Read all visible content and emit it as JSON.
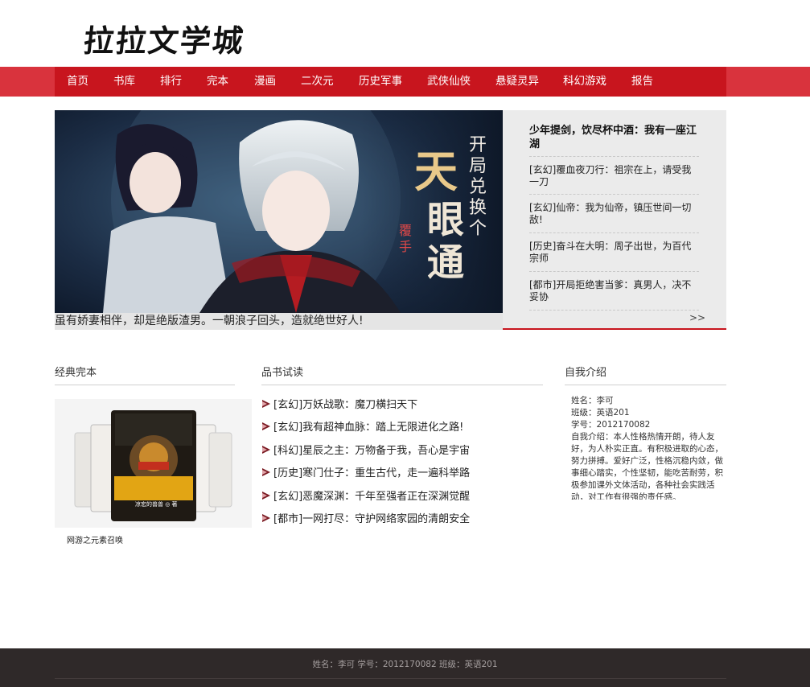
{
  "site": {
    "logo_text": "拉拉文学城"
  },
  "nav": {
    "items": [
      "首页",
      "书库",
      "排行",
      "完本",
      "漫画",
      "二次元",
      "历史军事",
      "武侠仙侠",
      "悬疑灵异",
      "科幻游戏",
      "报告"
    ]
  },
  "hero": {
    "cover_title": "开局兑换个天眼通",
    "cover_author": "覆手",
    "caption": "虽有娇妻相伴，却是绝版渣男。一朝浪子回头，造就绝世好人!"
  },
  "side": {
    "title": "少年提剑，饮尽杯中酒：我有一座江湖",
    "items": [
      "[玄幻]覆血夜刀行：祖宗在上，请受我一刀",
      "[玄幻]仙帝：我为仙帝，镇压世间一切敌!",
      "[历史]奋斗在大明：周子出世，为百代宗师",
      "[都市]开局拒绝害当爹：真男人，决不妥协"
    ],
    "more": ">>"
  },
  "sections": {
    "classic": "经典完本",
    "trial": "品书试读",
    "intro": "自我介绍"
  },
  "classic": {
    "cover_title": "网游之元素召唤",
    "cover_author": "凉宏的兽兽 ◎ 著",
    "caption": "网游之元素召唤"
  },
  "trial_items": [
    "[玄幻]万妖战歌：魔刀横扫天下",
    "[玄幻]我有超神血脉：踏上无限进化之路!",
    "[科幻]星辰之主：万物备于我，吾心是宇宙",
    "[历史]寒门仕子：重生古代，走一遍科举路",
    "[玄幻]恶魔深渊：千年至强者正在深渊觉醒",
    "[都市]一网打尽：守护网络家园的清朗安全"
  ],
  "intro": {
    "lines": [
      "姓名：李可",
      "班级：英语201",
      "学号：2012170082",
      "自我介绍：本人性格热情开朗，待人友好，为人朴实正直。有积极进取的心态，努力拼搏。爱好广泛，性格沉稳内敛，做事细心踏实，个性坚韧，能吃苦耐劳，积极参加课外文体活动，各种社会实践活动，对工作有很强的责任感。"
    ]
  },
  "footer": {
    "text": "姓名：李可 学号：2012170082 班级：英语201"
  },
  "colors": {
    "nav_red": "#c8151e",
    "nav_outer": "#d9333d",
    "footer_bg": "#2f2929"
  }
}
